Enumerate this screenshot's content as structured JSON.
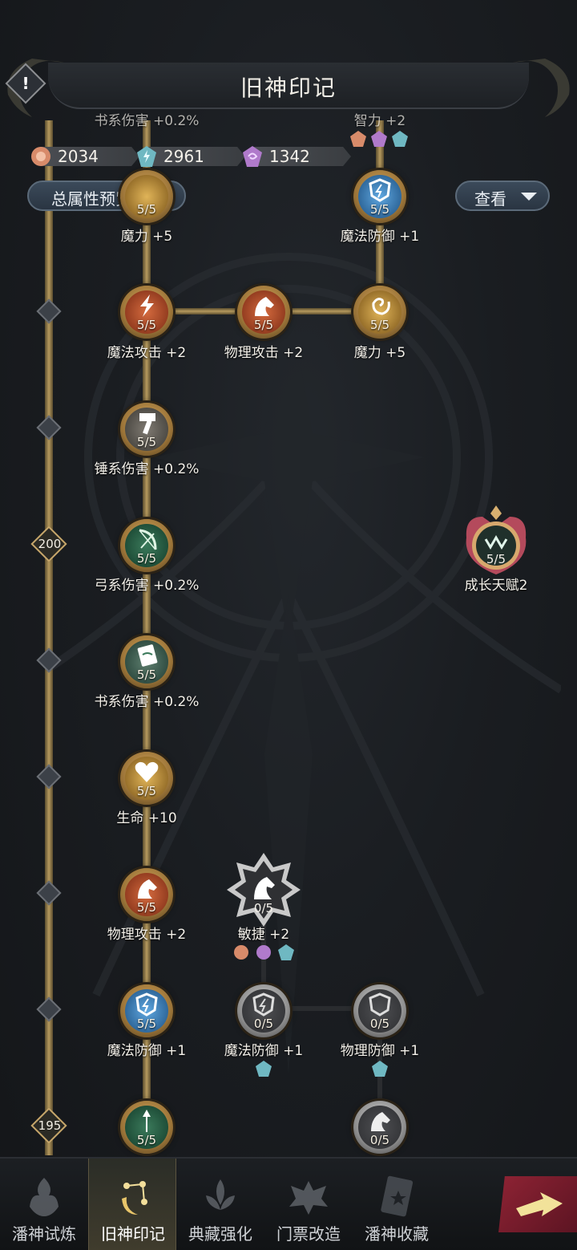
{
  "header": {
    "title": "旧神印记",
    "warning_symbol": "!"
  },
  "currencies": [
    {
      "icon": "rose-gem-icon",
      "value": "2034",
      "color": "#d88b6a"
    },
    {
      "icon": "teal-lightning-gem-icon",
      "value": "2961",
      "color": "#6fb8c2"
    },
    {
      "icon": "purple-swirl-gem-icon",
      "value": "1342",
      "color": "#b07acb"
    }
  ],
  "dropdowns": {
    "preview": "总属性预览",
    "view": "查看"
  },
  "partial_labels": {
    "left_top": "书系伤害 +0.2%",
    "right_top": "智力 +2"
  },
  "levels": {
    "upper": "200",
    "lower": "195"
  },
  "nodes": {
    "magic_power_top": {
      "count": "5/5",
      "label": "魔力 +5"
    },
    "magic_def_top": {
      "count": "5/5",
      "label": "魔法防御 +1"
    },
    "magic_atk": {
      "count": "5/5",
      "label": "魔法攻击 +2"
    },
    "phys_atk_mid": {
      "count": "5/5",
      "label": "物理攻击 +2"
    },
    "magic_power_mid": {
      "count": "5/5",
      "label": "魔力 +5"
    },
    "hammer": {
      "count": "5/5",
      "label": "锤系伤害 +0.2%"
    },
    "bow": {
      "count": "5/5",
      "label": "弓系伤害 +0.2%"
    },
    "book": {
      "count": "5/5",
      "label": "书系伤害 +0.2%"
    },
    "life": {
      "count": "5/5",
      "label": "生命 +10"
    },
    "phys_atk_low": {
      "count": "5/5",
      "label": "物理攻击 +2"
    },
    "agility": {
      "count": "0/5",
      "label": "敏捷 +2"
    },
    "magic_def_low": {
      "count": "5/5",
      "label": "魔法防御 +1"
    },
    "magic_def_locked": {
      "count": "0/5",
      "label": "魔法防御 +1"
    },
    "phys_def_locked": {
      "count": "0/5",
      "label": "物理防御 +1"
    },
    "spear": {
      "count": "5/5"
    },
    "last_locked": {
      "count": "0/5"
    },
    "growth_talent": {
      "count": "5/5",
      "label": "成长天赋2"
    }
  },
  "bottom_nav": [
    {
      "label": "潘神试炼",
      "icon": "flame-crest-icon",
      "active": false
    },
    {
      "label": "旧神印记",
      "icon": "moon-constellation-icon",
      "active": true
    },
    {
      "label": "典藏强化",
      "icon": "lotus-crest-icon",
      "active": false
    },
    {
      "label": "门票改造",
      "icon": "winged-crest-icon",
      "active": false
    },
    {
      "label": "潘神收藏",
      "icon": "star-card-icon",
      "active": false
    }
  ],
  "go_button": {
    "icon": "arrow-right-icon"
  },
  "colors": {
    "gold_line": "#b69a5e",
    "accent_red": "#8e2334",
    "node_gold": "#d8a85d"
  }
}
